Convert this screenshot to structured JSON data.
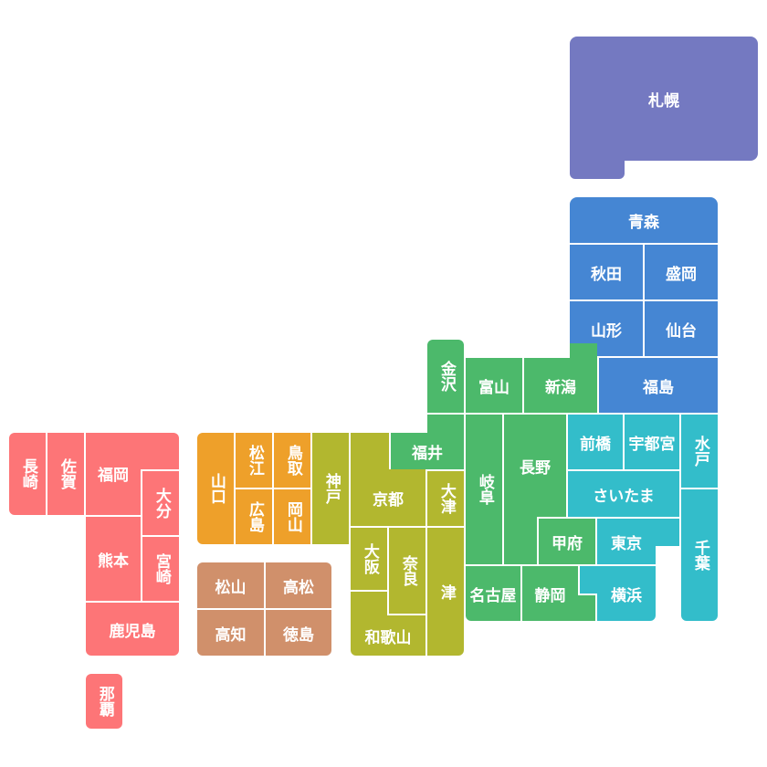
{
  "regions": {
    "hokkaido": {
      "color": "#7479c1"
    },
    "tohoku": {
      "color": "#4586d3"
    },
    "kanto": {
      "color": "#33bdca"
    },
    "chubu": {
      "color": "#4cb96b"
    },
    "kinki": {
      "color": "#b2b72f"
    },
    "chugoku": {
      "color": "#eea02a"
    },
    "shikoku": {
      "color": "#d0906b"
    },
    "kyushu": {
      "color": "#fd7577"
    }
  },
  "cities": {
    "sapporo": "札幌",
    "aomori": "青森",
    "akita": "秋田",
    "morioka": "盛岡",
    "yamagata": "山形",
    "sendai": "仙台",
    "fukushima": "福島",
    "maebashi": "前橋",
    "utsunomiya": "宇都宮",
    "mito": "水戸",
    "saitama": "さいたま",
    "tokyo": "東京",
    "chiba": "千葉",
    "yokohama": "横浜",
    "kanazawa": "金沢",
    "toyama": "富山",
    "niigata": "新潟",
    "fukui": "福井",
    "gifu": "岐阜",
    "nagano": "長野",
    "kofu": "甲府",
    "nagoya": "名古屋",
    "shizuoka": "静岡",
    "kobe": "神戸",
    "kyoto": "京都",
    "otsu": "大津",
    "osaka": "大阪",
    "nara": "奈良",
    "wakayama": "和歌山",
    "tsu": "津",
    "yamaguchi": "山口",
    "matsue": "松江",
    "tottori": "鳥取",
    "hiroshima": "広島",
    "okayama": "岡山",
    "matsuyama": "松山",
    "takamatsu": "高松",
    "kochi": "高知",
    "tokushima": "徳島",
    "nagasaki": "長崎",
    "saga": "佐賀",
    "fukuoka": "福岡",
    "oita": "大分",
    "kumamoto": "熊本",
    "miyazaki": "宮崎",
    "kagoshima": "鹿児島",
    "naha": "那覇"
  }
}
